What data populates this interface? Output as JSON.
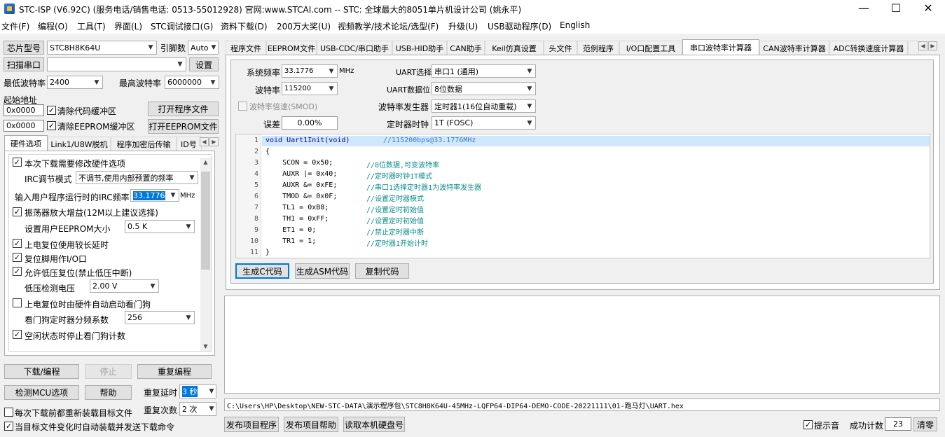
{
  "window": {
    "title": "STC-ISP (V6.92C) (服务电话/销售电话: 0513-55012928) 官网:www.STCAI.com  -- STC: 全球最大的8051单片机设计公司 (姚永平)",
    "minimize": "—",
    "maximize": "☐",
    "close": "✕"
  },
  "menu": [
    "文件(F)",
    "编程(O)",
    "工具(T)",
    "界面(L)",
    "STC调试接口(G)",
    "资料下载(D)",
    "200万大奖(U)",
    "视频教学/技术论坛/选型(F)",
    "升级(U)",
    "USB驱动程序(D)",
    "English"
  ],
  "left": {
    "chip_label": "芯片型号",
    "chip_value": "STC8H8K64U",
    "pins_label": "引脚数",
    "pins_value": "Auto",
    "scan_port_label": "扫描串口",
    "port_value": "",
    "settings_label": "设置",
    "min_baud_label": "最低波特率",
    "min_baud_value": "2400",
    "max_baud_label": "最高波特率",
    "max_baud_value": "6000000",
    "start_addr_label": "起始地址",
    "addr1": "0x0000",
    "clear_code_label": "清除代码缓冲区",
    "open_program_label": "打开程序文件",
    "addr2": "0x0000",
    "clear_eeprom_label": "清除EEPROM缓冲区",
    "open_eeprom_label": "打开EEPROM文件",
    "tabs": [
      "硬件选项",
      "Link1/U8W脱机",
      "程序加密后传输",
      "ID号"
    ],
    "hw_options": {
      "opt1": "本次下载需要修改硬件选项",
      "irc_mode_label": "IRC调节模式",
      "irc_mode_value": "不调节,使用内部预置的频率",
      "irc_freq_label": "输入用户程序运行时的IRC频率",
      "irc_freq_value": "33.1776",
      "irc_unit": "MHz",
      "opt2": "振荡器放大增益(12M以上建议选择)",
      "eeprom_size_label": "设置用户EEPROM大小",
      "eeprom_size_value": "0.5 K",
      "opt3": "上电复位使用较长延时",
      "opt4": "复位脚用作I/O口",
      "opt5": "允许低压复位(禁止低压中断)",
      "lv_label": "低压检测电压",
      "lv_value": "2.00 V",
      "opt6": "上电复位时由硬件自动启动看门狗",
      "wdt_label": "看门狗定时器分频系数",
      "wdt_value": "256",
      "opt7": "空闲状态时停止看门狗计数"
    },
    "download_label": "下载/编程",
    "stop_label": "停止",
    "reprogram_label": "重复编程",
    "detect_label": "检测MCU选项",
    "help_label": "帮助",
    "repeat_delay_label": "重复延时",
    "repeat_delay_value": "3 秒",
    "repeat_count_label": "重复次数",
    "repeat_count_value": "2 次",
    "reload_label": "每次下载前都重新装载目标文件",
    "autoload_label": "当目标文件变化时自动装载并发送下载命令"
  },
  "right": {
    "tabs": [
      "程序文件",
      "EEPROM文件",
      "USB-CDC/串口助手",
      "USB-HID助手",
      "CAN助手",
      "Keil仿真设置",
      "头文件",
      "范例程序",
      "I/O口配置工具",
      "串口波特率计算器",
      "CAN波特率计算器",
      "ADC转换速度计算器"
    ],
    "sysfreq_label": "系统频率",
    "sysfreq_value": "33.1776",
    "sysfreq_unit": "MHz",
    "uart_sel_label": "UART选择",
    "uart_sel_value": "串口1 (通用)",
    "baud_label": "波特率",
    "baud_value": "115200",
    "uart_bits_label": "UART数据位",
    "uart_bits_value": "8位数据",
    "smod_label": "波特率倍速(SMOD)",
    "gen_label": "波特率发生器",
    "gen_value": "定时器1(16位自动重载)",
    "error_label": "误差",
    "error_value": "0.00%",
    "clock_label": "定时器时钟",
    "clock_value": "1T  (FOSC)",
    "code": [
      {
        "n": "1",
        "code": "void Uart1Init(void)",
        "cm": "//115200bps@33.1776MHz"
      },
      {
        "n": "2",
        "code": "{",
        "cm": ""
      },
      {
        "n": "3",
        "code": "    SCON = 0x50;",
        "cm": "//8位数据,可变波特率"
      },
      {
        "n": "4",
        "code": "    AUXR |= 0x40;",
        "cm": "//定时器时钟1T模式"
      },
      {
        "n": "5",
        "code": "    AUXR &= 0xFE;",
        "cm": "//串口1选择定时器1为波特率发生器"
      },
      {
        "n": "6",
        "code": "    TMOD &= 0x0F;",
        "cm": "//设置定时器模式"
      },
      {
        "n": "7",
        "code": "    TL1 = 0xB8;",
        "cm": "//设置定时初始值"
      },
      {
        "n": "8",
        "code": "    TH1 = 0xFF;",
        "cm": "//设置定时初始值"
      },
      {
        "n": "9",
        "code": "    ET1 = 0;",
        "cm": "//禁止定时器中断"
      },
      {
        "n": "10",
        "code": "    TR1 = 1;",
        "cm": "//定时器1开始计时"
      },
      {
        "n": "11",
        "code": "}",
        "cm": ""
      }
    ],
    "gen_c_label": "生成C代码",
    "gen_asm_label": "生成ASM代码",
    "copy_label": "复制代码",
    "path": "C:\\Users\\HP\\Desktop\\NEW-STC-DATA\\演示程序包\\STC8H8K64U-45MHz-LQFP64-DIP64-DEMO-CODE-20221111\\01-跑马灯\\UART.hex",
    "publish_label": "发布项目程序",
    "publish_help_label": "发布项目帮助",
    "read_disk_label": "读取本机硬盘号",
    "sound_label": "提示音",
    "success_label": "成功计数",
    "success_value": "23",
    "clear_label": "清零"
  }
}
